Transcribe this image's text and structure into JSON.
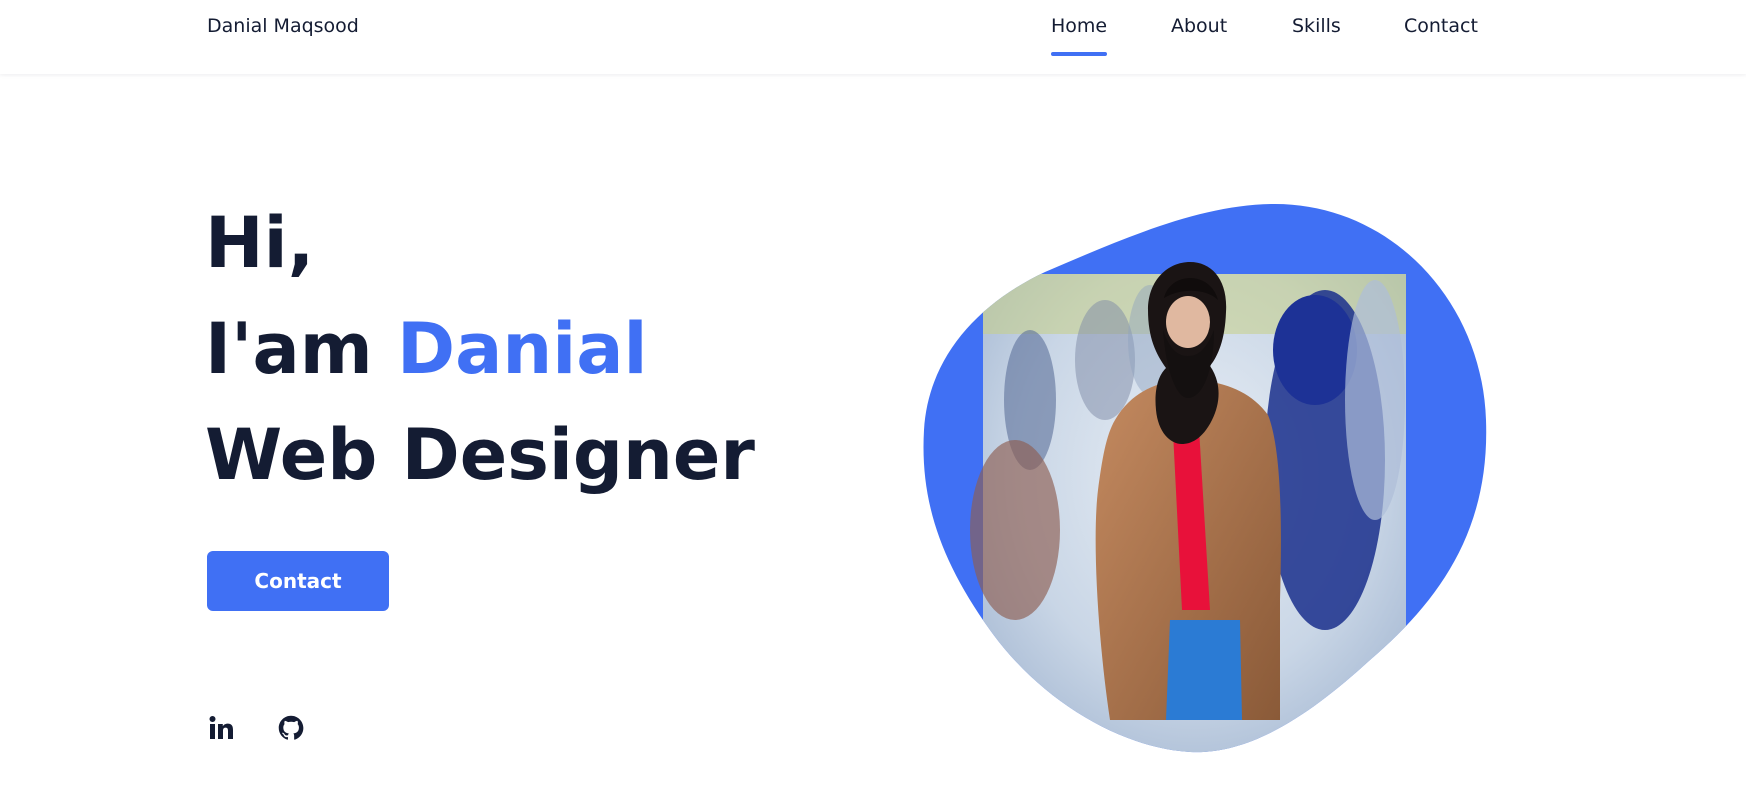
{
  "header": {
    "brand": "Danial Maqsood",
    "nav": [
      {
        "label": "Home",
        "active": true
      },
      {
        "label": "About",
        "active": false
      },
      {
        "label": "Skills",
        "active": false
      },
      {
        "label": "Contact",
        "active": false
      }
    ]
  },
  "hero": {
    "greeting": "Hi,",
    "intro_prefix": "I'am ",
    "intro_name": "Danial",
    "role": "Web Designer",
    "contact_button": "Contact"
  },
  "socials": [
    {
      "icon": "linkedin-icon",
      "label": "in"
    },
    {
      "icon": "github-icon"
    }
  ],
  "colors": {
    "accent": "#4070f4",
    "text": "#141c33",
    "background": "#ffffff"
  }
}
